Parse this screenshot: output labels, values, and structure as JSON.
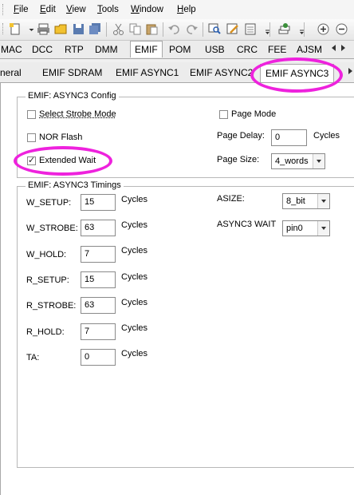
{
  "menu": {
    "items": [
      {
        "first": "F",
        "rest": "ile"
      },
      {
        "first": "E",
        "rest": "dit"
      },
      {
        "first": "V",
        "rest": "iew"
      },
      {
        "first": "T",
        "rest": "ools"
      },
      {
        "first": "W",
        "rest": "indow"
      },
      {
        "first": "H",
        "rest": "elp"
      }
    ]
  },
  "module_tabs": [
    "MAC",
    "DCC",
    "RTP",
    "DMM",
    "EMIF",
    "POM",
    "USB",
    "CRC",
    "FEE",
    "AJSM"
  ],
  "emif_tabs": [
    "neral",
    "EMIF SDRAM",
    "EMIF ASYNC1",
    "EMIF ASYNC2",
    "EMIF ASYNC3"
  ],
  "config": {
    "legend": "EMIF: ASYNC3 Config",
    "select_strobe_mode": "Select Strobe Mode",
    "nor_flash": "NOR Flash",
    "extended_wait": "Extended Wait",
    "page_mode": "Page Mode",
    "page_delay_label": "Page Delay:",
    "page_delay_value": "0",
    "page_delay_unit": "Cycles",
    "page_size_label": "Page Size:",
    "page_size_value": "4_words",
    "extended_wait_checked": true,
    "select_strobe_checked": false,
    "nor_flash_checked": false,
    "page_mode_checked": false
  },
  "timings": {
    "legend": "EMIF: ASYNC3 Timings",
    "cycles": "Cycles",
    "rows": [
      {
        "label": "W_SETUP:",
        "value": "15"
      },
      {
        "label": "W_STROBE:",
        "value": "63"
      },
      {
        "label": "W_HOLD:",
        "value": "7"
      },
      {
        "label": "R_SETUP:",
        "value": "15"
      },
      {
        "label": "R_STROBE:",
        "value": "63"
      },
      {
        "label": "R_HOLD:",
        "value": "7"
      },
      {
        "label": "TA:",
        "value": "0"
      }
    ],
    "asize_label": "ASIZE:",
    "asize_value": "8_bit",
    "async3_wait_label": "ASYNC3 WAIT",
    "async3_wait_value": "pin0"
  },
  "colors": {
    "highlight": "#ee22dd",
    "tab_active_bg": "#ffffff"
  }
}
